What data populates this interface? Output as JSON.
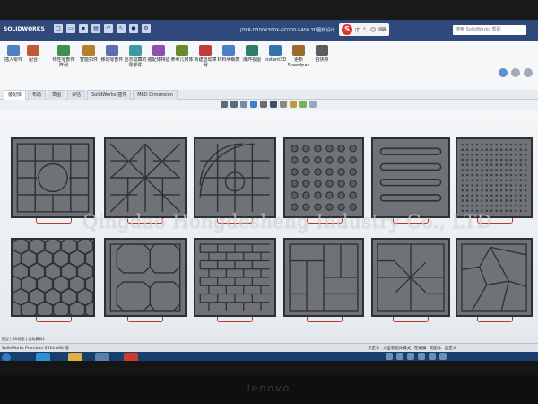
{
  "window": {
    "app_logo_text": "SOLIDWORKS",
    "document_title": "JDER-D300X300X-GD200-5400 3D图样设计",
    "search_placeholder": "搜索 SolidWorks 帮助"
  },
  "ime_bar": {
    "logo": "S",
    "items": [
      "中",
      "°,",
      "☺",
      "⌨"
    ]
  },
  "ribbon": {
    "buttons": [
      {
        "label": "插入零件",
        "color": "#4f7fc4"
      },
      {
        "label": "配合",
        "color": "#c0583a"
      },
      {
        "label": "线性零部件阵列",
        "color": "#3f8f4d"
      },
      {
        "label": "智能扣件",
        "color": "#b57f2c"
      },
      {
        "label": "移动零部件",
        "color": "#5b6fb3"
      },
      {
        "label": "显示隐藏的零部件",
        "color": "#3d9aa3"
      },
      {
        "label": "装配体特征",
        "color": "#8e4fb0"
      },
      {
        "label": "参考几何体",
        "color": "#6a8a2e"
      },
      {
        "label": "新建运动算例",
        "color": "#c43b3b"
      },
      {
        "label": "材料明细表",
        "color": "#4a7cc8"
      },
      {
        "label": "爆炸视图",
        "color": "#2f7d66"
      },
      {
        "label": "Instant3D",
        "color": "#3472b0"
      },
      {
        "label": "更新Speedpak",
        "color": "#9a6b2b"
      },
      {
        "label": "拍快照",
        "color": "#5d5d5d"
      }
    ],
    "tabs": [
      "装配体",
      "布局",
      "草图",
      "评估",
      "SolidWorks 插件",
      "MBD Dimension"
    ]
  },
  "graphics": {
    "watermark": "Qingdao Hongdesheng Industry Co., LTD"
  },
  "status": {
    "sheet_tabs": "模型  |  3D视图  |  运动算例1",
    "left_text": "SolidWorks Premium 2014 x64 版",
    "right_items": [
      "欠定义",
      "大型装配体模式",
      "在编辑 装配体",
      "自定义"
    ]
  },
  "taskbar": {
    "items": [
      "start",
      "ie",
      "explorer",
      "folder",
      "media",
      "solidworks"
    ]
  },
  "monitor": {
    "brand": "lenovo"
  }
}
